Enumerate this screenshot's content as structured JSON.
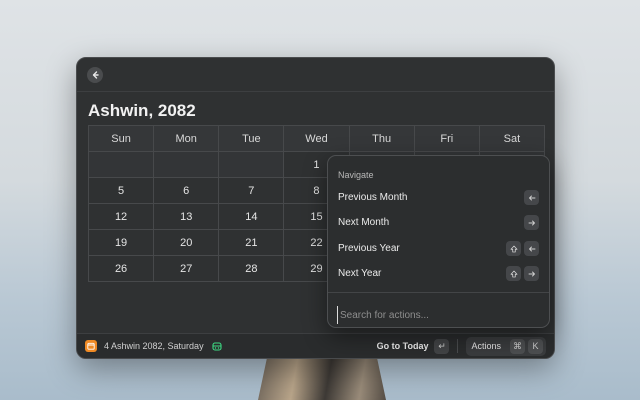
{
  "calendar": {
    "title": "Ashwin, 2082",
    "weekdays": [
      "Sun",
      "Mon",
      "Tue",
      "Wed",
      "Thu",
      "Fri",
      "Sat"
    ],
    "rows": [
      [
        "",
        "",
        "",
        "1",
        "",
        "",
        ""
      ],
      [
        "5",
        "6",
        "7",
        "8",
        "",
        "",
        ""
      ],
      [
        "12",
        "13",
        "14",
        "15",
        "",
        "",
        ""
      ],
      [
        "19",
        "20",
        "21",
        "22",
        "",
        "",
        ""
      ],
      [
        "26",
        "27",
        "28",
        "29",
        "",
        "",
        ""
      ]
    ]
  },
  "footer": {
    "status": "4 Ashwin 2082, Saturday",
    "goto_label": "Go to Today",
    "goto_key": "↵",
    "actions_label": "Actions",
    "actions_keys": [
      "⌘",
      "K"
    ]
  },
  "menu": {
    "heading": "Navigate",
    "items": [
      {
        "label": "Previous Month",
        "keys": [
          "←"
        ]
      },
      {
        "label": "Next Month",
        "keys": [
          "→"
        ]
      },
      {
        "label": "Previous Year",
        "keys": [
          "⇧",
          "←"
        ]
      },
      {
        "label": "Next Year",
        "keys": [
          "⇧",
          "→"
        ]
      }
    ],
    "search_placeholder": "Search for actions..."
  },
  "colors": {
    "accent": "#f08a24",
    "robot": "#3ddc84"
  },
  "icons": {
    "back": "arrow-left-icon",
    "calendar": "calendar-icon",
    "robot": "robot-icon"
  }
}
